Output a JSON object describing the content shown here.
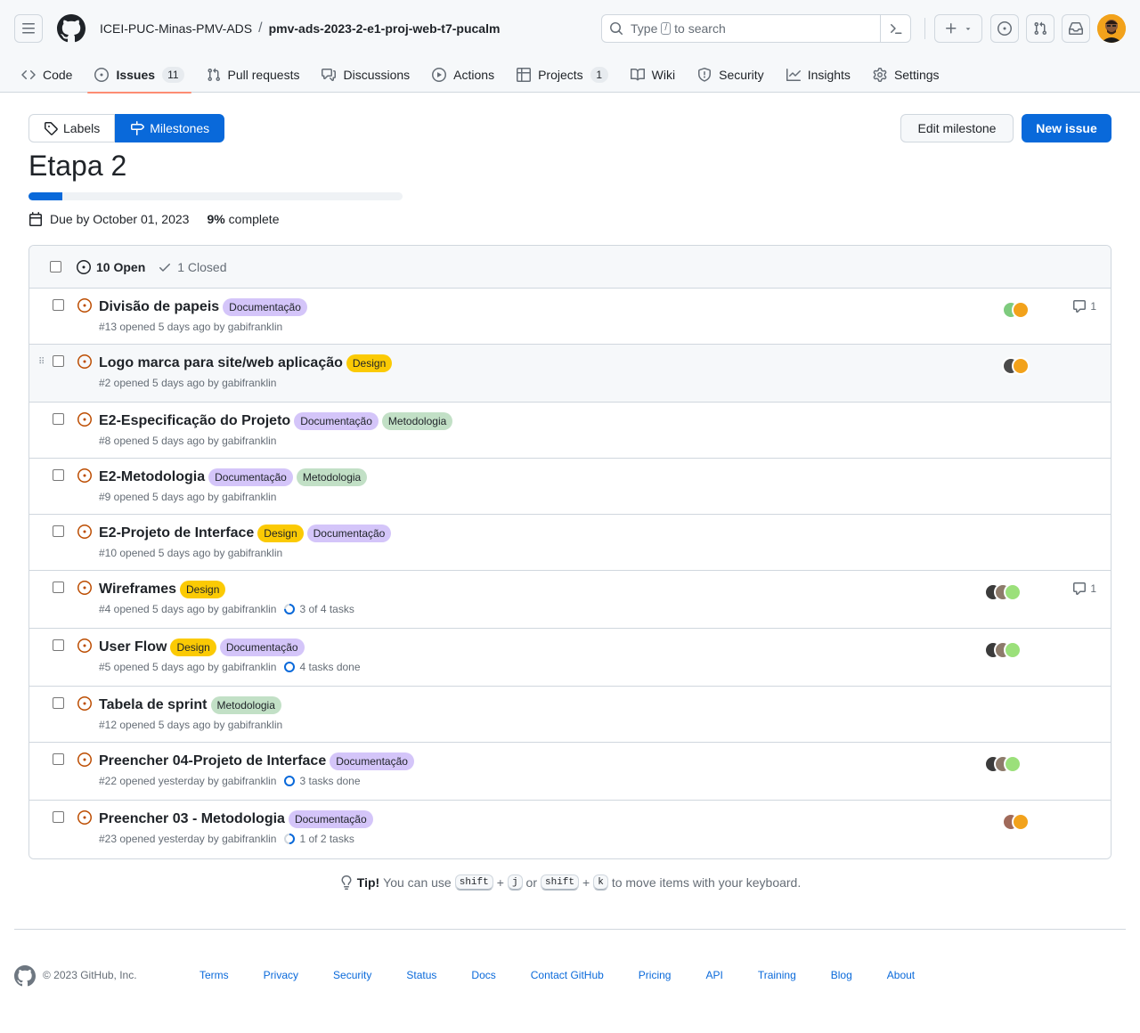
{
  "header": {
    "owner": "ICEI-PUC-Minas-PMV-ADS",
    "separator": "/",
    "repo": "pmv-ads-2023-2-e1-proj-web-t7-pucalm",
    "search_prefix": "Type",
    "search_key": "/",
    "search_suffix": "to search"
  },
  "nav": {
    "code": "Code",
    "issues": "Issues",
    "issues_count": "11",
    "pulls": "Pull requests",
    "discussions": "Discussions",
    "actions": "Actions",
    "projects": "Projects",
    "projects_count": "1",
    "wiki": "Wiki",
    "security": "Security",
    "insights": "Insights",
    "settings": "Settings"
  },
  "subnav": {
    "labels": "Labels",
    "milestones": "Milestones"
  },
  "buttons": {
    "edit_milestone": "Edit milestone",
    "new_issue": "New issue"
  },
  "milestone": {
    "title": "Etapa 2",
    "progress_percent": 9,
    "due": "Due by October 01, 2023",
    "percent_label": "9%",
    "complete_label": "complete"
  },
  "states": {
    "open": "10 Open",
    "closed": "1 Closed"
  },
  "colors": {
    "accent": "#0969da",
    "open_icon": "#bc4c00",
    "label_documentacao_bg": "#d4c5f9",
    "label_design_bg": "#fbca04",
    "label_metodologia_bg": "#c2e0c6"
  },
  "issues": [
    {
      "title": "Divisão de papeis",
      "labels": [
        "Documentação"
      ],
      "meta": "#13 opened 5 days ago by gabifranklin",
      "tasks": "",
      "comments": "1"
    },
    {
      "title": "Logo marca para site/web aplicação",
      "labels": [
        "Design"
      ],
      "meta": "#2 opened 5 days ago by gabifranklin",
      "tasks": "",
      "comments": ""
    },
    {
      "title": "E2-Especificação do Projeto",
      "labels": [
        "Documentação",
        "Metodologia"
      ],
      "meta": "#8 opened 5 days ago by gabifranklin",
      "tasks": "",
      "comments": ""
    },
    {
      "title": "E2-Metodologia",
      "labels": [
        "Documentação",
        "Metodologia"
      ],
      "meta": "#9 opened 5 days ago by gabifranklin",
      "tasks": "",
      "comments": ""
    },
    {
      "title": "E2-Projeto de Interface",
      "labels": [
        "Design",
        "Documentação"
      ],
      "meta": "#10 opened 5 days ago by gabifranklin",
      "tasks": "",
      "comments": ""
    },
    {
      "title": "Wireframes",
      "labels": [
        "Design"
      ],
      "meta": "#4 opened 5 days ago by gabifranklin",
      "tasks": "3 of 4 tasks",
      "comments": "1"
    },
    {
      "title": "User Flow",
      "labels": [
        "Design",
        "Documentação"
      ],
      "meta": "#5 opened 5 days ago by gabifranklin",
      "tasks": "4 tasks done",
      "comments": ""
    },
    {
      "title": "Tabela de sprint",
      "labels": [
        "Metodologia"
      ],
      "meta": "#12 opened 5 days ago by gabifranklin",
      "tasks": "",
      "comments": ""
    },
    {
      "title": "Preencher 04-Projeto de Interface",
      "labels": [
        "Documentação"
      ],
      "meta": "#22 opened yesterday by gabifranklin",
      "tasks": "3 tasks done",
      "comments": ""
    },
    {
      "title": "Preencher 03 - Metodologia",
      "labels": [
        "Documentação"
      ],
      "meta": "#23 opened yesterday by gabifranklin",
      "tasks": "1 of 2 tasks",
      "comments": ""
    }
  ],
  "tip": {
    "bold": "Tip!",
    "text1": "You can use",
    "key_shift": "shift",
    "plus": "+",
    "key_j": "j",
    "or": "or",
    "key_k": "k",
    "text2": "to move items with your keyboard."
  },
  "footer": {
    "copyright": "© 2023 GitHub, Inc.",
    "links": [
      "Terms",
      "Privacy",
      "Security",
      "Status",
      "Docs",
      "Contact GitHub",
      "Pricing",
      "API",
      "Training",
      "Blog",
      "About"
    ]
  }
}
